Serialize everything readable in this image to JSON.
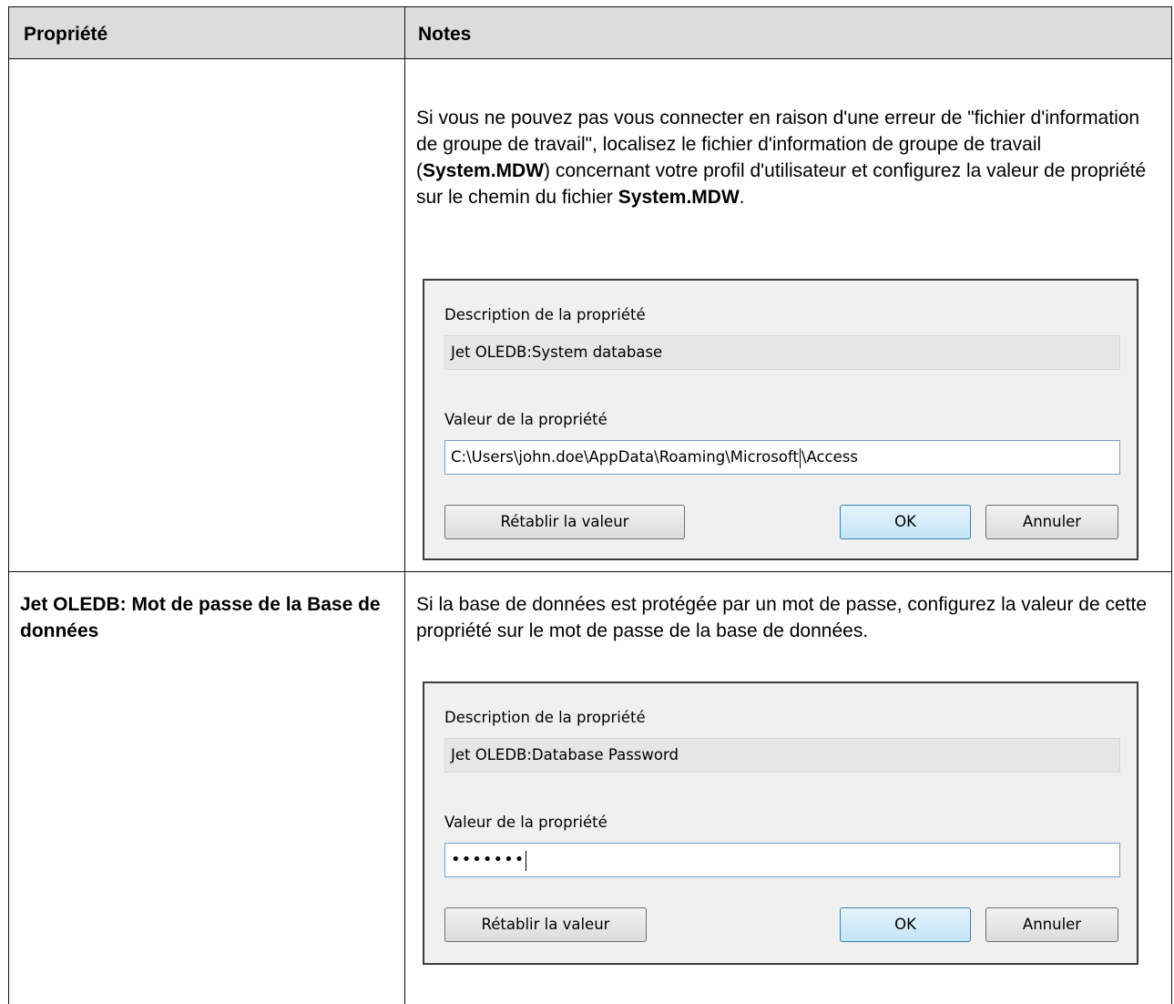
{
  "table": {
    "headers": {
      "property": "Propriété",
      "notes": "Notes"
    },
    "rows": [
      {
        "property": "",
        "note_parts": [
          "Si vous ne pouvez pas vous connecter en raison d'une erreur de \"fichier d'information de groupe de travail\", localisez le fichier d'information de groupe de travail (",
          "System.MDW",
          ") concernant votre profil d'utilisateur et configurez la valeur de propriété sur le chemin du fichier ",
          "System.MDW",
          "."
        ],
        "dialog": {
          "desc_label": "Description de la propriété",
          "desc_value": "Jet OLEDB:System database",
          "value_label": "Valeur de la propriété",
          "value_before_caret": "C:\\Users\\john.doe\\AppData\\Roaming\\Microsoft",
          "value_after_caret": "\\Access",
          "reset_label": "Rétablir la valeur",
          "ok_label": "OK",
          "cancel_label": "Annuler"
        }
      },
      {
        "property": "Jet OLEDB: Mot de passe de la Base de données",
        "note": "Si la base de données est protégée par un mot de passe, configurez la valeur de cette propriété sur le mot de passe de la base de données.",
        "dialog": {
          "desc_label": "Description de la propriété",
          "desc_value": "Jet OLEDB:Database Password",
          "value_label": "Valeur de la propriété",
          "value_masked": "•••••••",
          "reset_label": "Rétablir la valeur",
          "ok_label": "OK",
          "cancel_label": "Annuler"
        }
      }
    ]
  }
}
